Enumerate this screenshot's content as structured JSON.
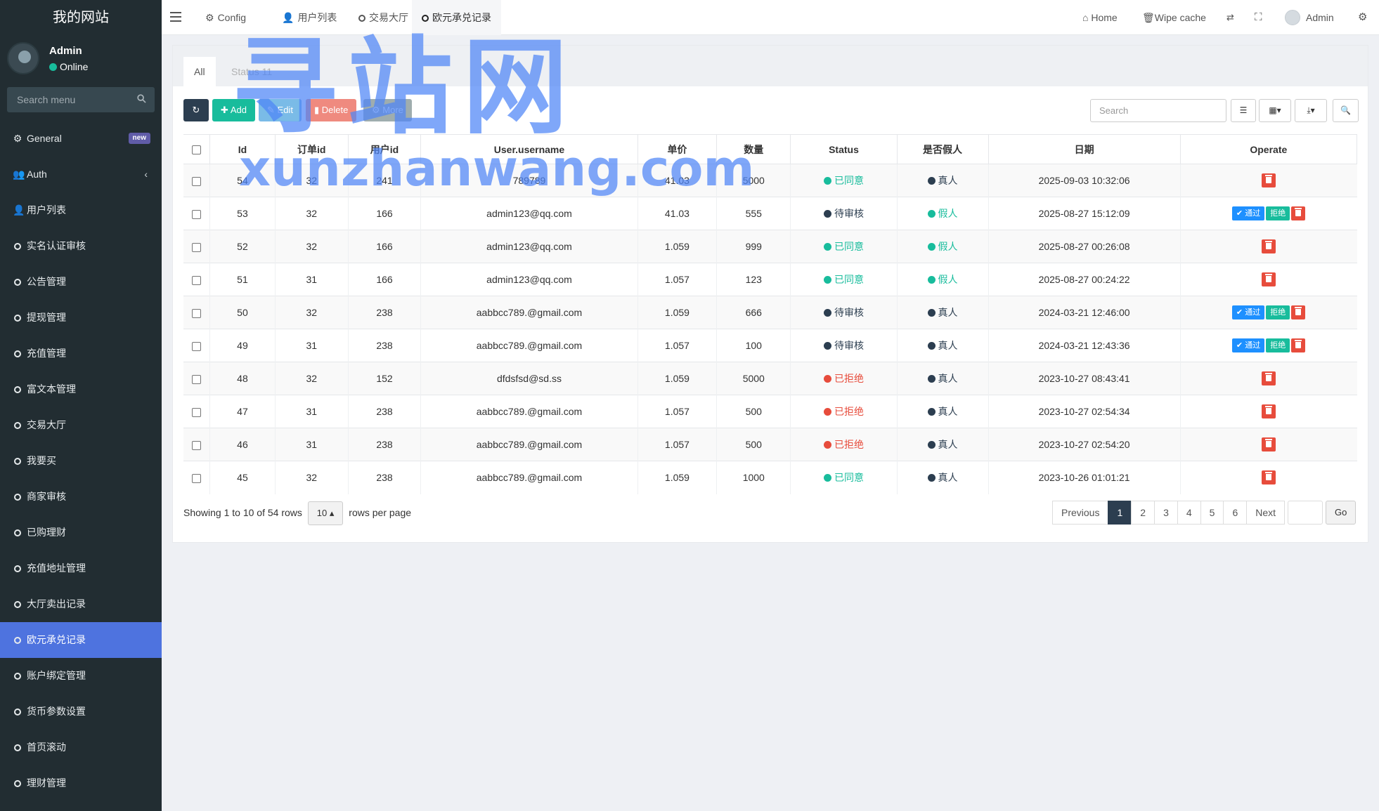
{
  "sidebar": {
    "logo": "我的网站",
    "user_name": "Admin",
    "user_status": "Online",
    "search_placeholder": "Search menu",
    "badge_new": "new",
    "items": [
      {
        "label": "General",
        "icon": "cogs-icon"
      },
      {
        "label": "Auth",
        "icon": "users-icon"
      },
      {
        "label": "用户列表",
        "icon": "user-icon"
      },
      {
        "label": "实名认证审核",
        "icon": "circle-icon"
      },
      {
        "label": "公告管理",
        "icon": "circle-icon"
      },
      {
        "label": "提现管理",
        "icon": "circle-icon"
      },
      {
        "label": "充值管理",
        "icon": "circle-icon"
      },
      {
        "label": "富文本管理",
        "icon": "circle-icon"
      },
      {
        "label": "交易大厅",
        "icon": "circle-icon"
      },
      {
        "label": "我要买",
        "icon": "circle-icon"
      },
      {
        "label": "商家审核",
        "icon": "circle-icon"
      },
      {
        "label": "已购理财",
        "icon": "circle-icon"
      },
      {
        "label": "充值地址管理",
        "icon": "circle-icon"
      },
      {
        "label": "大厅卖出记录",
        "icon": "circle-icon"
      },
      {
        "label": "欧元承兑记录",
        "icon": "circle-icon"
      },
      {
        "label": "账户绑定管理",
        "icon": "circle-icon"
      },
      {
        "label": "货币参数设置",
        "icon": "circle-icon"
      },
      {
        "label": "首页滚动",
        "icon": "circle-icon"
      },
      {
        "label": "理财管理",
        "icon": "circle-icon"
      }
    ]
  },
  "header": {
    "tabs": [
      {
        "label": "Config"
      },
      {
        "label": "用户列表"
      },
      {
        "label": "交易大厅"
      },
      {
        "label": "欧元承兑记录"
      }
    ],
    "home": "Home",
    "wipe_cache": "Wipe cache",
    "admin": "Admin"
  },
  "panel": {
    "tabs": [
      {
        "label": "All"
      },
      {
        "label": "Status 11"
      }
    ],
    "toolbar": {
      "add": "Add",
      "edit": "Edit",
      "delete": "Delete",
      "more": "More"
    },
    "search_placeholder": "Search"
  },
  "table": {
    "headers": [
      "Id",
      "订单id",
      "用户id",
      "User.username",
      "单价",
      "数量",
      "Status",
      "是否假人",
      "日期",
      "Operate"
    ],
    "rows": [
      {
        "id": "54",
        "order": "32",
        "uid": "241",
        "username": "789789",
        "price": "41.03",
        "qty": "5000",
        "status": "已同意",
        "st": "agree",
        "fake": "真人",
        "fk": "real",
        "date": "2025-09-03 10:32:06",
        "ops": "del"
      },
      {
        "id": "53",
        "order": "32",
        "uid": "166",
        "username": "admin123@qq.com",
        "price": "41.03",
        "qty": "555",
        "status": "待审核",
        "st": "wait",
        "fake": "假人",
        "fk": "fake",
        "date": "2025-08-27 15:12:09",
        "ops": "full"
      },
      {
        "id": "52",
        "order": "32",
        "uid": "166",
        "username": "admin123@qq.com",
        "price": "1.059",
        "qty": "999",
        "status": "已同意",
        "st": "agree",
        "fake": "假人",
        "fk": "fake",
        "date": "2025-08-27 00:26:08",
        "ops": "del"
      },
      {
        "id": "51",
        "order": "31",
        "uid": "166",
        "username": "admin123@qq.com",
        "price": "1.057",
        "qty": "123",
        "status": "已同意",
        "st": "agree",
        "fake": "假人",
        "fk": "fake",
        "date": "2025-08-27 00:24:22",
        "ops": "del"
      },
      {
        "id": "50",
        "order": "32",
        "uid": "238",
        "username": "aabbcc789.@gmail.com",
        "price": "1.059",
        "qty": "666",
        "status": "待审核",
        "st": "wait",
        "fake": "真人",
        "fk": "real",
        "date": "2024-03-21 12:46:00",
        "ops": "full"
      },
      {
        "id": "49",
        "order": "31",
        "uid": "238",
        "username": "aabbcc789.@gmail.com",
        "price": "1.057",
        "qty": "100",
        "status": "待审核",
        "st": "wait",
        "fake": "真人",
        "fk": "real",
        "date": "2024-03-21 12:43:36",
        "ops": "full"
      },
      {
        "id": "48",
        "order": "32",
        "uid": "152",
        "username": "dfdsfsd@sd.ss",
        "price": "1.059",
        "qty": "5000",
        "status": "已拒绝",
        "st": "rej",
        "fake": "真人",
        "fk": "real",
        "date": "2023-10-27 08:43:41",
        "ops": "del"
      },
      {
        "id": "47",
        "order": "31",
        "uid": "238",
        "username": "aabbcc789.@gmail.com",
        "price": "1.057",
        "qty": "500",
        "status": "已拒绝",
        "st": "rej",
        "fake": "真人",
        "fk": "real",
        "date": "2023-10-27 02:54:34",
        "ops": "del"
      },
      {
        "id": "46",
        "order": "31",
        "uid": "238",
        "username": "aabbcc789.@gmail.com",
        "price": "1.057",
        "qty": "500",
        "status": "已拒绝",
        "st": "rej",
        "fake": "真人",
        "fk": "real",
        "date": "2023-10-27 02:54:20",
        "ops": "del"
      },
      {
        "id": "45",
        "order": "32",
        "uid": "238",
        "username": "aabbcc789.@gmail.com",
        "price": "1.059",
        "qty": "1000",
        "status": "已同意",
        "st": "agree",
        "fake": "真人",
        "fk": "real",
        "date": "2023-10-26 01:01:21",
        "ops": "del"
      }
    ],
    "op_pass": "通过",
    "op_refuse": "拒绝"
  },
  "footer": {
    "showing": "Showing 1 to 10 of 54 rows",
    "page_size": "10",
    "rows_per_page": "rows per page",
    "prev": "Previous",
    "pages": [
      "1",
      "2",
      "3",
      "4",
      "5",
      "6"
    ],
    "active_page": "1",
    "next": "Next",
    "go": "Go"
  },
  "watermark": {
    "big": "寻站网",
    "small": "xunzhanwang.com"
  },
  "colors": {
    "sidebar_bg": "#222d32",
    "active_menu": "#4e73df",
    "agree": "#18bc9c",
    "wait": "#2c3e50",
    "reject": "#e74c3c",
    "pass_btn": "#1e90ff"
  }
}
